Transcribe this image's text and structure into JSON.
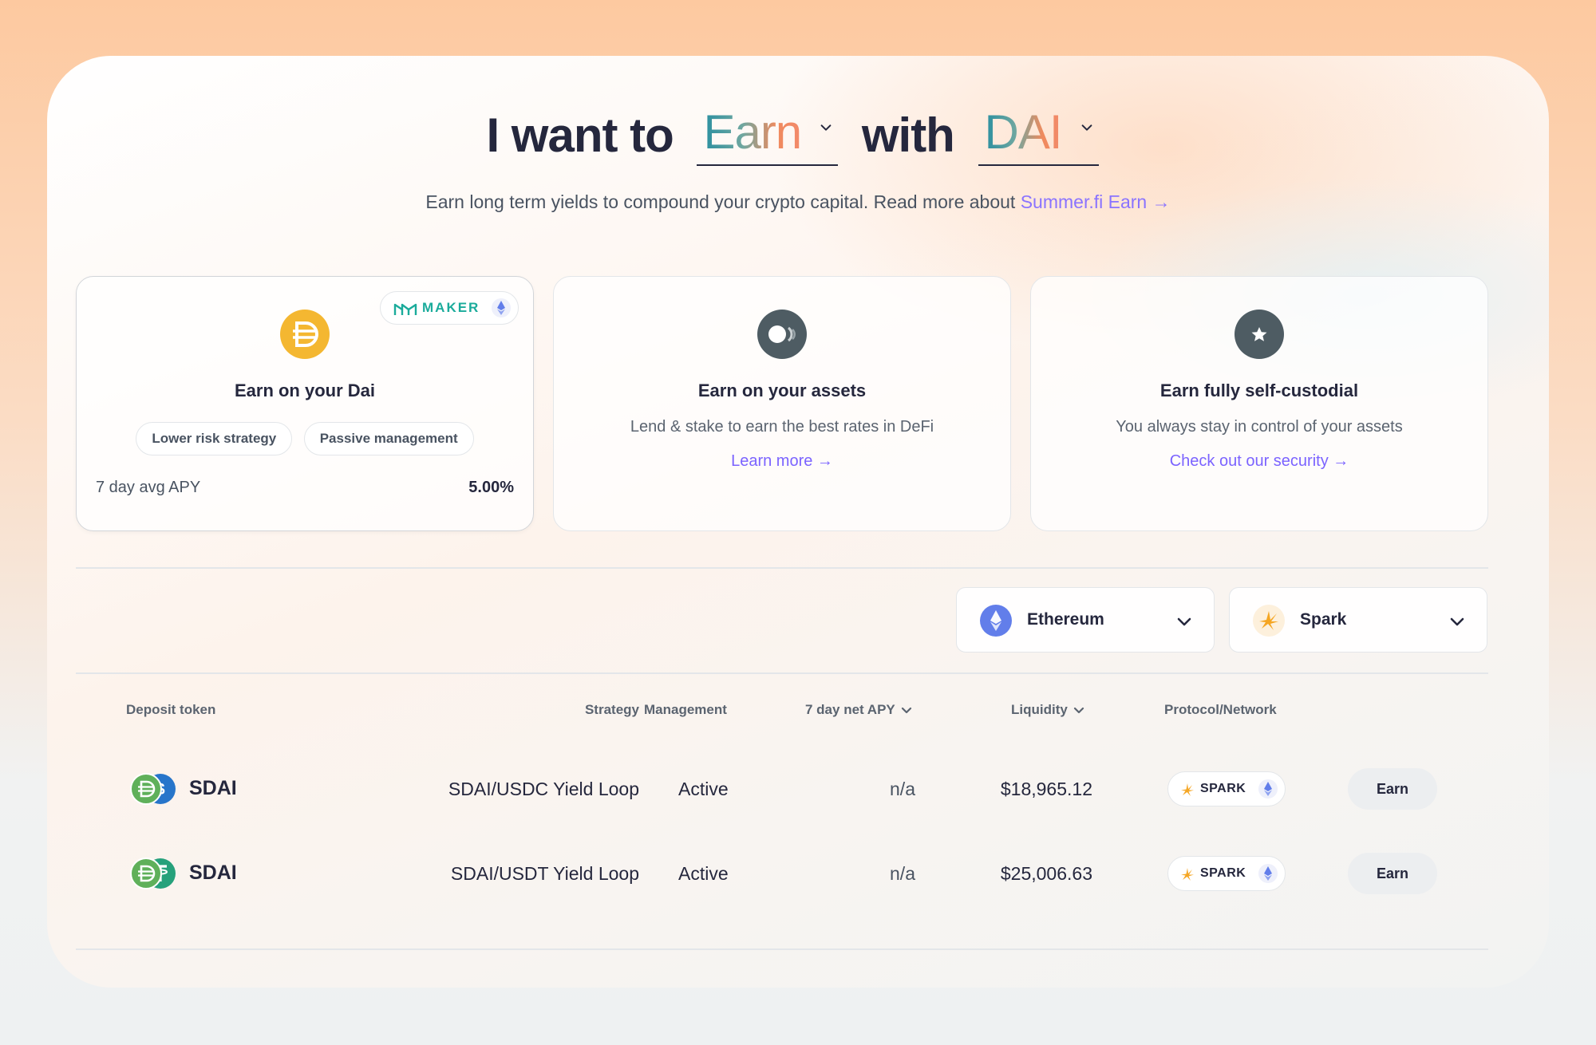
{
  "hero": {
    "prefix": "I want to",
    "action": "Earn",
    "middle": "with",
    "token": "DAI"
  },
  "subtitle": {
    "text": "Earn long term yields to compound your crypto capital. Read more about",
    "link": "Summer.fi Earn  →"
  },
  "cards": [
    {
      "badge": "MAKER",
      "title": "Earn on your Dai",
      "tags": [
        "Lower risk strategy",
        "Passive management"
      ],
      "apy_label": "7 day avg APY",
      "apy_value": "5.00%"
    },
    {
      "title": "Earn on your assets",
      "description": "Lend & stake to earn the best rates in DeFi",
      "link": "Learn more →"
    },
    {
      "title": "Earn fully self-custodial",
      "description": "You always stay in control of your assets",
      "link": "Check out our security →"
    }
  ],
  "filters": {
    "network": "Ethereum",
    "protocol": "Spark"
  },
  "table": {
    "headers": {
      "deposit_token": "Deposit token",
      "strategy": "Strategy",
      "management": "Management",
      "apy": "7 day net APY",
      "liquidity": "Liquidity",
      "protocol": "Protocol/Network"
    },
    "rows": [
      {
        "token": "SDAI",
        "strategy": "SDAI/USDC Yield Loop",
        "management": "Active",
        "apy": "n/a",
        "liquidity": "$18,965.12",
        "protocol": "SPARK",
        "action": "Earn"
      },
      {
        "token": "SDAI",
        "strategy": "SDAI/USDT Yield Loop",
        "management": "Active",
        "apy": "n/a",
        "liquidity": "$25,006.63",
        "protocol": "SPARK",
        "action": "Earn"
      }
    ]
  },
  "colors": {
    "accent_link": "#7b63ff",
    "maker_teal": "#1aab9b",
    "dai_yellow": "#f4b731",
    "ethereum": "#627eea",
    "spark_orange": "#f5a623"
  }
}
